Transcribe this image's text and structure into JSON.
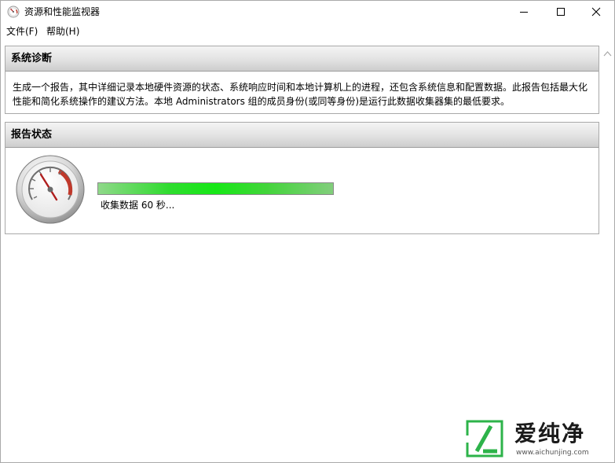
{
  "window": {
    "title": "资源和性能监视器",
    "icon": "gauge-icon"
  },
  "menu": {
    "file": "文件(F)",
    "help": "帮助(H)"
  },
  "diagnosis": {
    "header": "系统诊断",
    "description_line1": "生成一个报告，其中详细记录本地硬件资源的状态、系统响应时间和本地计算机上的进程，还包含系统信息和配置数据。此报告包括最大化",
    "description_line2": "性能和简化系统操作的建议方法。本地 Administrators 组的成员身份(或同等身份)是运行此数据收集器集的最低要求。"
  },
  "report_status": {
    "header": "报告状态",
    "progress_fraction": 1.0,
    "progress_text": "收集数据 60 秒..."
  },
  "watermark": {
    "brand": "爱纯净",
    "url": "www.aichunjing.com"
  },
  "colors": {
    "progress_green": "#16e816",
    "header_gradient_top": "#f4f4f4",
    "header_gradient_bottom": "#cdcdcd",
    "border": "#a9a9a9",
    "watermark_green": "#2db34a"
  }
}
